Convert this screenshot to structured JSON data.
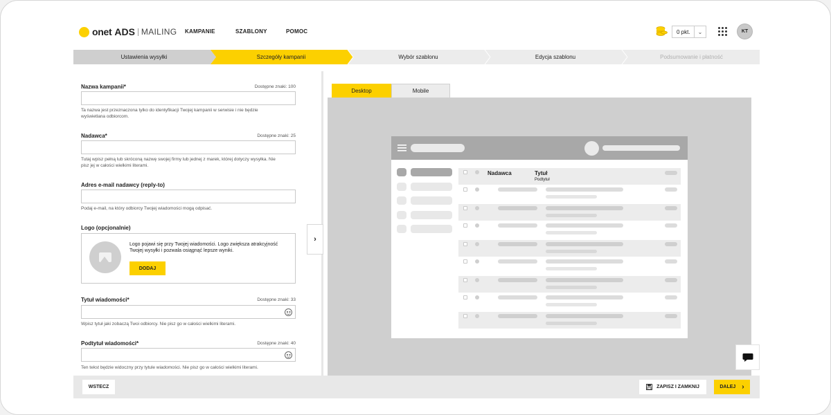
{
  "app": {
    "logo_brand": "onet",
    "logo_ads": "ADS",
    "logo_product": "MAILING"
  },
  "nav": {
    "kampanie": "KAMPANIE",
    "szablony": "SZABLONY",
    "pomoc": "POMOC"
  },
  "account": {
    "points": "0 pkt.",
    "initials": "KT"
  },
  "steps": [
    {
      "label": "Ustawienia wysyłki",
      "state": "done"
    },
    {
      "label": "Szczegóły kampanii",
      "state": "active"
    },
    {
      "label": "Wybór szablonu",
      "state": "todo"
    },
    {
      "label": "Edycja szablonu",
      "state": "todo"
    },
    {
      "label": "Podsumowanie i płatność",
      "state": "disabled"
    }
  ],
  "form": {
    "campaign_name": {
      "label": "Nazwa kampanii*",
      "counter": "Dostępne znaki: 100",
      "value": "",
      "help": "Ta nazwa jest przeznaczona tylko do identyfikacji Twojej kampanii w serwisie i nie będzie wyświetlana odbiorcom."
    },
    "sender": {
      "label": "Nadawca*",
      "counter": "Dostępne znaki: 25",
      "value": "",
      "help": "Tutaj wpisz pełną lub skróconą nazwę swojej firmy lub jednej z marek, której dotyczy wysyłka. Nie pisz jej w całości wielkimi literami."
    },
    "reply_to": {
      "label": "Adres e-mail nadawcy (reply-to)",
      "value": "",
      "help": "Podaj e-mail, na który odbiorcy Twojej wiadomości mogą odpisać."
    },
    "logo": {
      "label": "Logo (opcjonalnie)",
      "text": "Logo pojawi się przy Twojej wiadomości. Logo zwiększa atrakcyjność Twojej wysyłki i pozwala osiągnąć lepsze wyniki.",
      "button": "DODAJ"
    },
    "title": {
      "label": "Tytuł wiadomości*",
      "counter": "Dostępne znaki: 33",
      "value": "",
      "help": "Wpisz tytuł jaki zobaczą Twoi odbiorcy. Nie pisz go w całości wielkimi literami."
    },
    "subtitle": {
      "label": "Podtytuł wiadomości*",
      "counter": "Dostępne znaki: 40",
      "value": "",
      "help": "Ten tekst będzie widoczny przy tytule wiadomości. Nie pisz go w całości wielkimi literami."
    }
  },
  "preview": {
    "tab_desktop": "Desktop",
    "tab_mobile": "Mobile",
    "active_tab": "Desktop",
    "col_sender": "Nadawca",
    "col_title": "Tytuł",
    "col_subtitle": "Podtytuł"
  },
  "footer": {
    "back": "WSTECZ",
    "save_close": "ZAPISZ I ZAMKNIJ",
    "next": "DALEJ"
  },
  "colors": {
    "accent": "#fcd000",
    "step_done": "#cfcfcf",
    "step_todo": "#ececec",
    "preview_bg": "#cfcfcf"
  },
  "icons": [
    "coins-icon",
    "chevron-down-icon",
    "apps-grid-icon",
    "image-placeholder-icon",
    "emoji-icon",
    "chevron-right-icon",
    "hamburger-icon",
    "chat-icon",
    "save-icon"
  ]
}
